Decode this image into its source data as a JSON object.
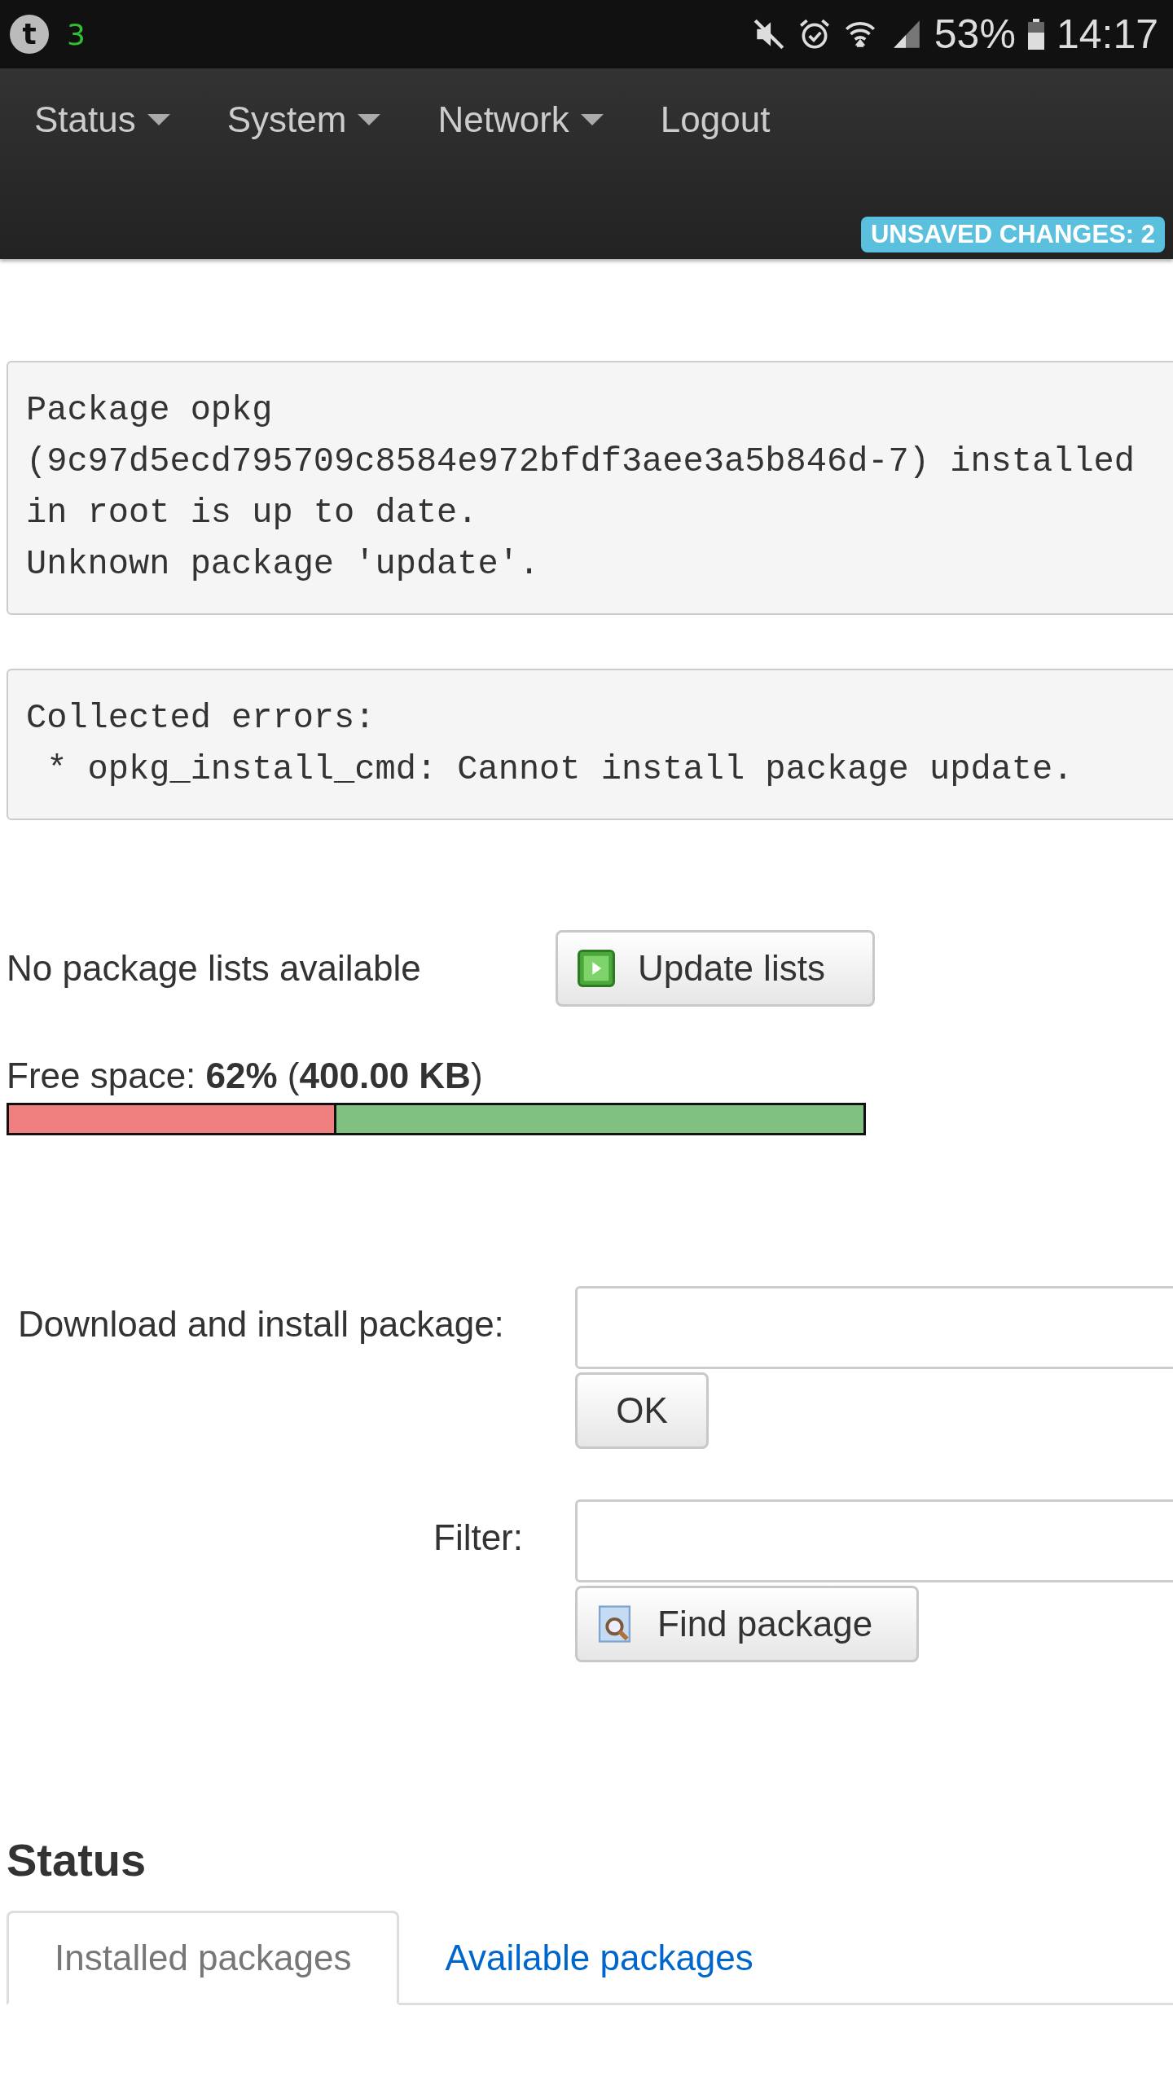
{
  "status_bar": {
    "app_letter": "t",
    "notification_count": "3",
    "battery": "53%",
    "time": "14:17"
  },
  "nav": {
    "items": [
      {
        "label": "Status",
        "dropdown": true
      },
      {
        "label": "System",
        "dropdown": true
      },
      {
        "label": "Network",
        "dropdown": true
      },
      {
        "label": "Logout",
        "dropdown": false
      }
    ],
    "badge": "UNSAVED CHANGES: 2"
  },
  "output_boxes": [
    [
      "Package opkg",
      "(9c97d5ecd795709c8584e972bfdf3aee3a5b846d-7) installed",
      "in root is up to date.",
      "Unknown package 'update'."
    ],
    [
      "Collected errors:",
      " * opkg_install_cmd: Cannot install package update."
    ]
  ],
  "package_lists": {
    "message": "No package lists available",
    "button": "Update lists"
  },
  "free_space": {
    "text": "Free space: **62%** (**400.00 KB**)",
    "level": 0.62
  },
  "install": {
    "label": "Download and install package:",
    "button": "OK"
  },
  "filter": {
    "label": "Filter:",
    "button": "Find package"
  },
  "status_section": {
    "heading": "Status",
    "tabs": [
      {
        "label": "Installed packages",
        "selected": true
      },
      {
        "label": "Available packages",
        "selected": false
      }
    ]
  }
}
